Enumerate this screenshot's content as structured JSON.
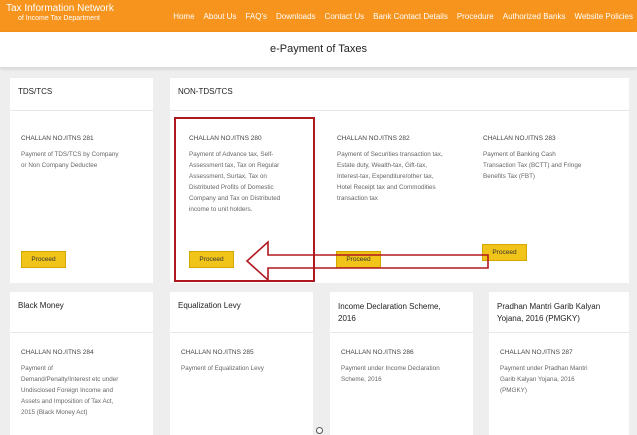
{
  "header": {
    "brand_title": "Tax Information Network",
    "brand_sub": "of Income Tax Department",
    "nav": [
      "Home",
      "About Us",
      "FAQ's",
      "Downloads",
      "Contact Us",
      "Bank Contact Details",
      "Procedure",
      "Authorized Banks",
      "Website Policies"
    ]
  },
  "page_title": "e-Payment of Taxes",
  "sections": {
    "tds": "TDS/TCS",
    "non_tds": "NON-TDS/TCS"
  },
  "cards": {
    "itns281": {
      "challan": "CHALLAN NO./ITNS 281",
      "desc": [
        "Payment of TDS/TCS by Company",
        "or Non Company Deductee"
      ],
      "button": "Proceed"
    },
    "itns280": {
      "challan": "CHALLAN NO./ITNS 280",
      "desc": [
        "Payment of Advance tax, Self-",
        "Assessment tax, Tax on Regular",
        "Assessment, Surtax, Tax on",
        "Distributed Profits of Domestic",
        "Company and Tax on Distributed",
        "income to unit holders."
      ],
      "button": "Proceed"
    },
    "itns282": {
      "challan": "CHALLAN NO./ITNS 282",
      "desc": [
        "Payment of Securities transaction tax,",
        "Estate duty, Wealth-tax, Gift-tax,",
        "Interest-tax, Expenditure/other tax,",
        "Hotel Receipt tax and Commodities",
        "transaction tax"
      ],
      "button": "Proceed"
    },
    "itns283": {
      "challan": "CHALLAN NO./ITNS 283",
      "desc": [
        "Payment of Banking Cash",
        "Transaction Tax (BCTT) and Fringe",
        "Benefits Tax (FBT)"
      ],
      "button": "Proceed"
    },
    "itns284": {
      "title": "Black Money",
      "challan": "CHALLAN NO./ITNS 284",
      "desc": [
        "Payment of",
        "Demand/Penalty/Interest etc under",
        "Undisclosed Foreign Income and",
        "Assets and Imposition of Tax Act,",
        "2015 (Black Money Act)"
      ]
    },
    "itns285": {
      "title": "Equalization Levy",
      "challan": "CHALLAN NO./ITNS 285",
      "desc": [
        "Payment of Equalization Levy"
      ]
    },
    "itns286": {
      "title": [
        "Income Declaration Scheme,",
        "2016"
      ],
      "challan": "CHALLAN NO./ITNS 286",
      "desc": [
        "Payment under Income Declaration",
        "Scheme, 2016"
      ]
    },
    "itns287": {
      "title": [
        "Pradhan Mantri Garib Kalyan",
        "Yojana, 2016 (PMGKY)"
      ],
      "challan": "CHALLAN NO./ITNS 287",
      "desc": [
        "Payment under Pradhan Mantri",
        "Garib Kalyan Yojana, 2016",
        "(PMGKY)"
      ]
    }
  },
  "colors": {
    "header_bg": "#f7941d",
    "button_bg": "#f0c419",
    "annotation": "#b0181f"
  }
}
